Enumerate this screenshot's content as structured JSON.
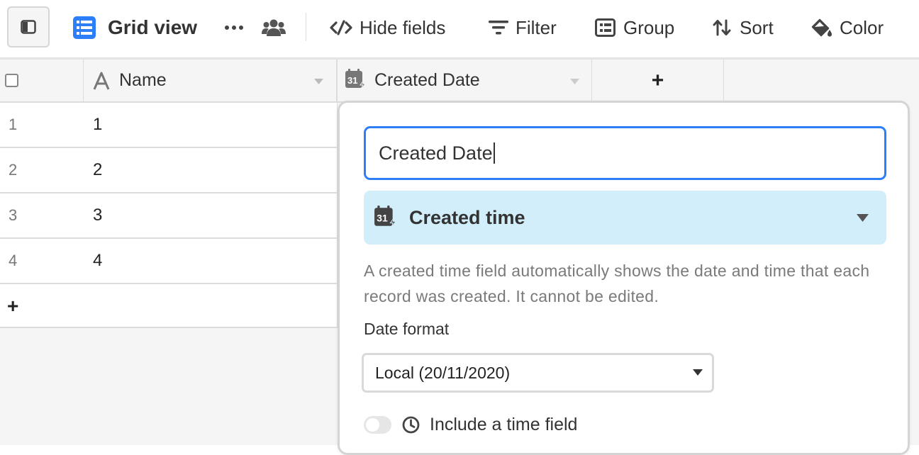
{
  "toolbar": {
    "view_name": "Grid view",
    "hide_fields": "Hide fields",
    "filter": "Filter",
    "group": "Group",
    "sort": "Sort",
    "color": "Color"
  },
  "grid": {
    "columns": [
      {
        "name": "Name",
        "icon": "text-field-icon"
      },
      {
        "name": "Created Date",
        "icon": "created-time-icon"
      }
    ],
    "add_field": "+",
    "rows": [
      {
        "num": "1",
        "name": "1"
      },
      {
        "num": "2",
        "name": "2"
      },
      {
        "num": "3",
        "name": "3"
      },
      {
        "num": "4",
        "name": "4"
      }
    ],
    "add_row": "+"
  },
  "field_editor": {
    "field_name": "Created Date",
    "field_type": "Created time",
    "description": "A created time field automatically shows the date and time that each record was created. It cannot be edited.",
    "date_format_label": "Date format",
    "date_format_value": "Local (20/11/2020)",
    "include_time_label": "Include a time field",
    "include_time_on": false
  },
  "colors": {
    "accent_blue": "#2d7ff9",
    "type_select_bg": "#d1eefa",
    "grid_bg": "#f5f5f5"
  }
}
